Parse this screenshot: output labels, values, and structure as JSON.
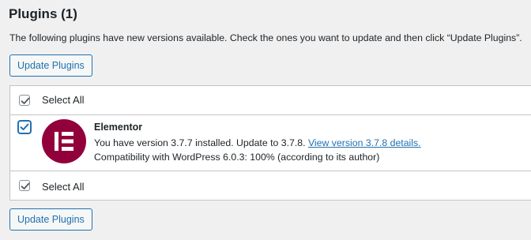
{
  "page": {
    "title": "Plugins (1)",
    "description": "The following plugins have new versions available. Check the ones you want to update and then click “Update Plugins”."
  },
  "buttons": {
    "update_top": "Update Plugins",
    "update_bottom": "Update Plugins"
  },
  "table": {
    "select_all_top": "Select All",
    "select_all_bottom": "Select All",
    "select_all_checked": true,
    "plugin": {
      "name": "Elementor",
      "checked": true,
      "version_text": "You have version 3.7.7 installed. Update to 3.7.8.",
      "details_link": "View version 3.7.8 details.",
      "compatibility": "Compatibility with WordPress 6.0.3: 100% (according to its author)",
      "icon": "elementor-logo",
      "icon_color": "#92003b"
    }
  },
  "colors": {
    "accent": "#2271b1",
    "background": "#f0f0f1"
  }
}
